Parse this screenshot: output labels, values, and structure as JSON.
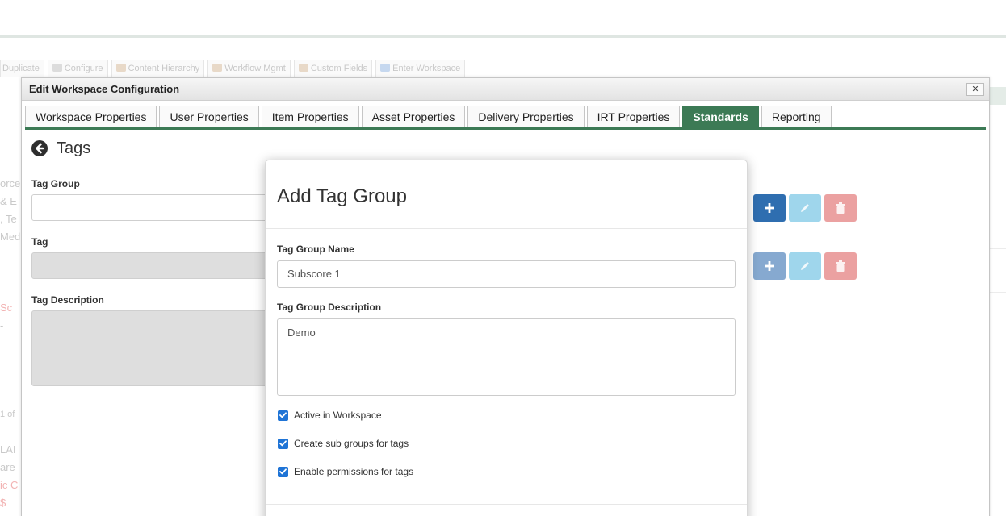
{
  "toolbar": {
    "items": [
      {
        "label": "Duplicate"
      },
      {
        "label": "Configure"
      },
      {
        "label": "Content Hierarchy"
      },
      {
        "label": "Workflow Mgmt"
      },
      {
        "label": "Custom Fields"
      },
      {
        "label": "Enter Workspace"
      }
    ]
  },
  "background_fragments": [
    "orce",
    "& E",
    ", Te",
    "Med",
    "Sc",
    "- ",
    "1 of",
    "LAI",
    "are",
    "ic C",
    "$"
  ],
  "dialog": {
    "title": "Edit Workspace Configuration",
    "close_label": "✕",
    "tabs": [
      {
        "label": "Workspace Properties",
        "active": false
      },
      {
        "label": "User Properties",
        "active": false
      },
      {
        "label": "Item Properties",
        "active": false
      },
      {
        "label": "Asset Properties",
        "active": false
      },
      {
        "label": "Delivery Properties",
        "active": false
      },
      {
        "label": "IRT Properties",
        "active": false
      },
      {
        "label": "Standards",
        "active": true
      },
      {
        "label": "Reporting",
        "active": false
      }
    ],
    "section_title": "Tags",
    "tag_group_label": "Tag Group",
    "tag_label": "Tag",
    "tag_description_label": "Tag Description",
    "icons": {
      "back": "arrow-circle-left-icon",
      "add": "plus-icon",
      "edit": "pencil-icon",
      "delete": "trash-icon"
    }
  },
  "modal": {
    "title": "Add Tag Group",
    "name_label": "Tag Group Name",
    "name_value": "Subscore 1",
    "description_label": "Tag Group Description",
    "description_value": "Demo",
    "checkboxes": [
      {
        "label": "Active in Workspace",
        "checked": true
      },
      {
        "label": "Create sub groups for tags",
        "checked": true
      },
      {
        "label": "Enable permissions for tags",
        "checked": true
      }
    ]
  },
  "colors": {
    "accent_green": "#3c7a55",
    "primary_blue": "#2f6eb0",
    "edit_light_blue": "#9fd6ec",
    "delete_light_red": "#eba1a1",
    "checkbox_blue": "#1f74d6"
  }
}
